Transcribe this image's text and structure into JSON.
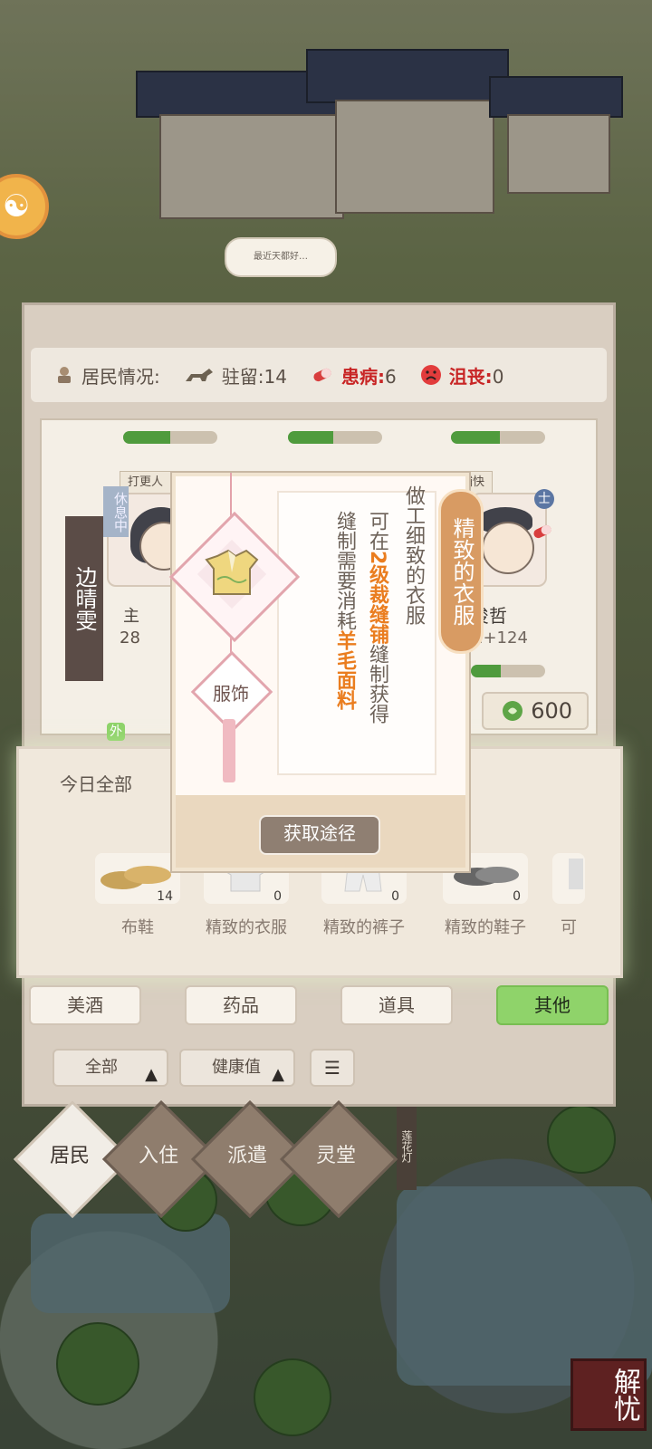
{
  "background": {
    "bubble_text": "最近天都好…",
    "lotus_sign": "莲花灯",
    "corner_badge": "解忧"
  },
  "status": {
    "residents_label": "居民情况:",
    "stay_label": "驻留:",
    "stay_value": "14",
    "sick_label": "患病:",
    "sick_value": "6",
    "sad_label": "沮丧:",
    "sad_value": "0"
  },
  "residents": {
    "left_name": "边晴雯",
    "left_status": "休息中",
    "left_partial_name": "主",
    "left_partial_num": "28",
    "left_tag": "打更人",
    "left_small_tag": "外",
    "right_name": "俊哲",
    "right_value": "+124",
    "right_partial_prefix": "1",
    "right_tag": "捕快",
    "right_badge": "士",
    "coins": "600"
  },
  "items_section": {
    "title": "今日全部",
    "items": [
      {
        "name": "布鞋",
        "count": "14"
      },
      {
        "name": "精致的衣服",
        "count": "0"
      },
      {
        "name": "精致的裤子",
        "count": "0"
      },
      {
        "name": "精致的鞋子",
        "count": "0"
      },
      {
        "name": "可",
        "count": ""
      }
    ]
  },
  "tabs": [
    "美酒",
    "药品",
    "道具",
    "其他"
  ],
  "active_tab": "其他",
  "filters": {
    "all": "全部",
    "health": "健康值"
  },
  "nav": [
    "居民",
    "入住",
    "派遣",
    "灵堂"
  ],
  "active_nav": "居民",
  "popup": {
    "title": "精致的衣服",
    "category": "服饰",
    "line1": "做工细致的衣服",
    "line2_prefix": "可在",
    "line2_highlight": "2级裁缝铺",
    "line2_suffix": "缝制获得",
    "line3_prefix": "缝制需要消耗",
    "line3_highlight": "羊毛面料",
    "button": "获取途径"
  },
  "colors": {
    "active_tab": "#8fd36a",
    "highlight": "#ea7d1f",
    "red": "#c82525"
  }
}
